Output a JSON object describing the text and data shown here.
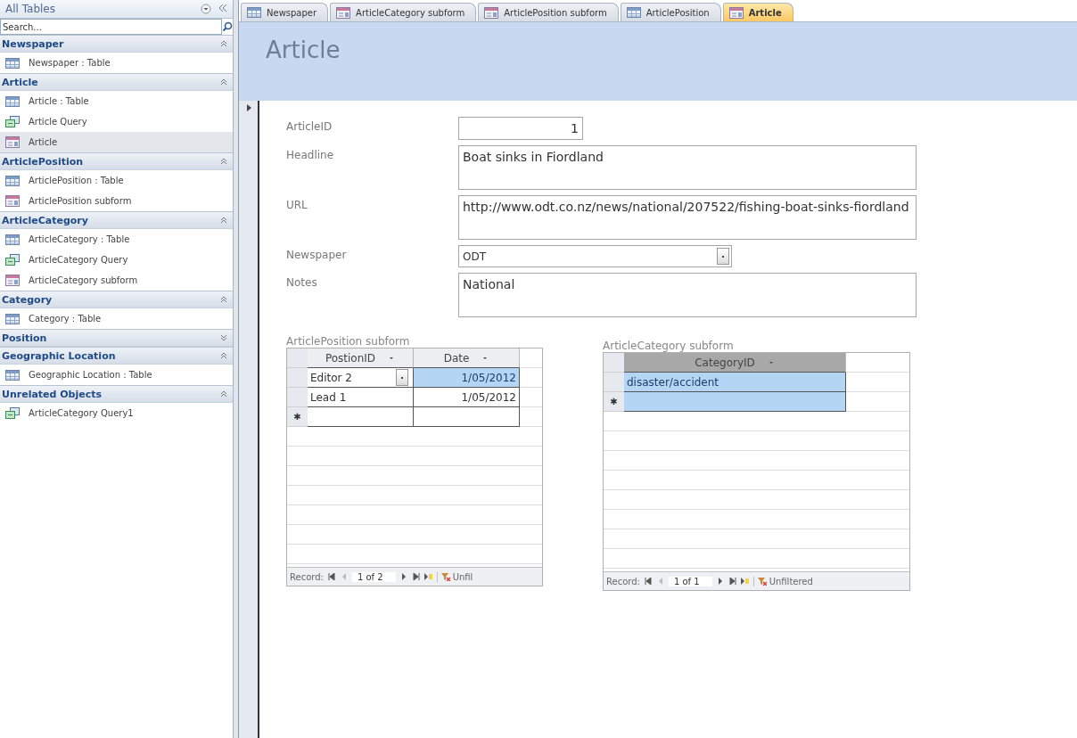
{
  "nav": {
    "title": "All Tables",
    "search_placeholder": "Search...",
    "groups": [
      {
        "name": "Newspaper",
        "expanded": true,
        "items": [
          {
            "label": "Newspaper : Table",
            "kind": "table",
            "selected": false
          }
        ]
      },
      {
        "name": "Article",
        "expanded": true,
        "items": [
          {
            "label": "Article : Table",
            "kind": "table",
            "selected": false
          },
          {
            "label": "Article Query",
            "kind": "query",
            "selected": false
          },
          {
            "label": "Article",
            "kind": "form",
            "selected": true
          }
        ]
      },
      {
        "name": "ArticlePosition",
        "expanded": true,
        "items": [
          {
            "label": "ArticlePosition : Table",
            "kind": "table",
            "selected": false
          },
          {
            "label": "ArticlePosition subform",
            "kind": "form",
            "selected": false
          }
        ]
      },
      {
        "name": "ArticleCategory",
        "expanded": true,
        "items": [
          {
            "label": "ArticleCategory : Table",
            "kind": "table",
            "selected": false
          },
          {
            "label": "ArticleCategory Query",
            "kind": "query",
            "selected": false
          },
          {
            "label": "ArticleCategory subform",
            "kind": "form",
            "selected": false
          }
        ]
      },
      {
        "name": "Category",
        "expanded": true,
        "items": [
          {
            "label": "Category : Table",
            "kind": "table",
            "selected": false
          }
        ]
      },
      {
        "name": "Position",
        "expanded": false
      },
      {
        "name": "Geographic Location",
        "expanded": true,
        "items": [
          {
            "label": "Geographic Location : Table",
            "kind": "table",
            "selected": false
          }
        ]
      },
      {
        "name": "Unrelated Objects",
        "expanded": true,
        "items": [
          {
            "label": "ArticleCategory Query1",
            "kind": "query",
            "selected": false
          }
        ]
      }
    ]
  },
  "tabs": [
    {
      "label": "Newspaper",
      "kind": "table",
      "selected": false
    },
    {
      "label": "ArticleCategory subform",
      "kind": "form",
      "selected": false
    },
    {
      "label": "ArticlePosition subform",
      "kind": "form",
      "selected": false
    },
    {
      "label": "ArticlePosition",
      "kind": "table",
      "selected": false
    },
    {
      "label": "Article",
      "kind": "form",
      "selected": true
    }
  ],
  "form": {
    "title": "Article",
    "fields": [
      {
        "label": "ArticleID",
        "value": "1",
        "kind": "number"
      },
      {
        "label": "Headline",
        "value": "Boat sinks in Fiordland",
        "kind": "multiline"
      },
      {
        "label": "URL",
        "value": "http://www.odt.co.nz/news/national/207522/fishing-boat-sinks-fiordland",
        "kind": "multiline"
      },
      {
        "label": "Newspaper",
        "value": "ODT",
        "kind": "combo"
      },
      {
        "label": "Notes",
        "value": "National",
        "kind": "multiline"
      }
    ]
  },
  "subforms": [
    {
      "label": "ArticlePosition subform",
      "columns": [
        {
          "name": "PostionID",
          "selected": false
        },
        {
          "name": "Date",
          "selected": false
        }
      ],
      "rows": [
        {
          "cells": [
            {
              "text": "Editor 2",
              "kind": "combo",
              "selected": false
            },
            {
              "text": "1/05/2012",
              "kind": "date",
              "selected": true
            }
          ]
        },
        {
          "cells": [
            {
              "text": "Lead 1",
              "kind": "text",
              "selected": false
            },
            {
              "text": "1/05/2012",
              "kind": "date",
              "selected": false
            }
          ]
        }
      ],
      "new_row": {
        "marker": "✱",
        "selected": false
      },
      "navigation": {
        "label": "Record:",
        "position": "1 of 2",
        "filter": "Unfil"
      }
    },
    {
      "label": "ArticleCategory subform",
      "columns": [
        {
          "name": "CategoryID",
          "selected": true
        }
      ],
      "rows": [
        {
          "cells": [
            {
              "text": "disaster/accident",
              "kind": "text",
              "selected": true
            }
          ]
        }
      ],
      "new_row": {
        "marker": "✱",
        "selected": true
      },
      "navigation": {
        "label": "Record:",
        "position": "1 of 1",
        "filter": "Unfiltered"
      }
    }
  ]
}
